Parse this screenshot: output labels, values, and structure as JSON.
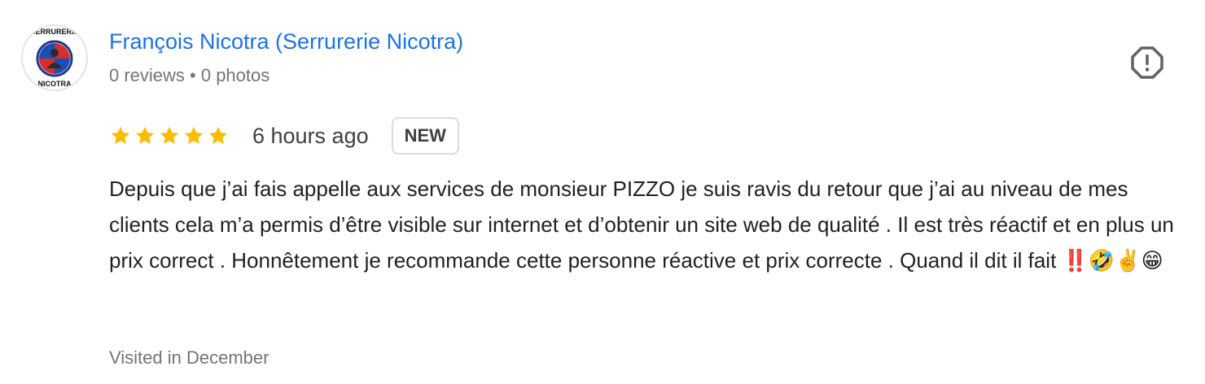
{
  "author": {
    "name": "François Nicotra (Serrurerie Nicotra)",
    "meta": "0 reviews • 0 photos",
    "avatar_top_text": "SERRURERIE",
    "avatar_bottom_text": "NICOTRA"
  },
  "review": {
    "rating": 5,
    "time_ago": "6 hours ago",
    "badge": "NEW",
    "text": "Depuis que j’ai fais appelle aux services de monsieur PIZZO je suis ravis du retour que j’ai au niveau de mes clients cela m’a permis d’être visible sur internet et d’obtenir un site web de qualité . Il est très réactif et en plus un prix correct . Honnêtement je recommande cette personne réactive et prix correcte . Quand il dit il fait ‼️🤣✌️😁",
    "visited": "Visited in December"
  },
  "icons": {
    "report": "report-flag-octagon-icon",
    "star": "star-icon"
  },
  "colors": {
    "link": "#1a73e8",
    "star": "#fbbc04",
    "muted": "#70757a"
  }
}
